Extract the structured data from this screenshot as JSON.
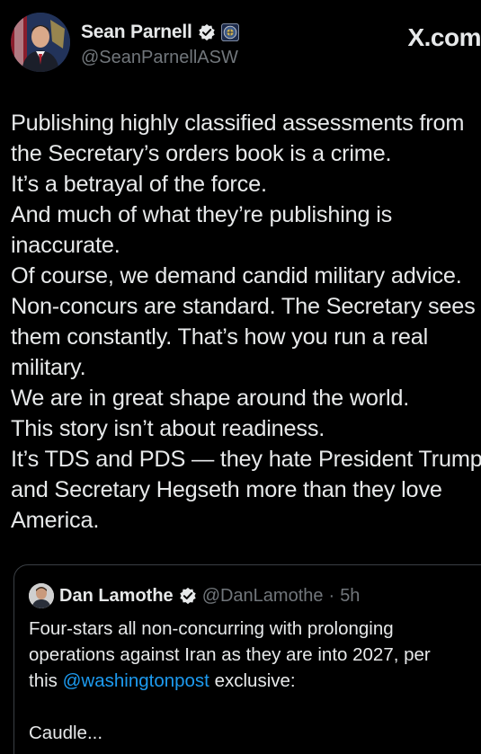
{
  "author": {
    "name": "Sean Parnell",
    "handle": "@SeanParnellASW",
    "verified_icon": "verified-badge-icon",
    "affiliation_icon": "dod-seal-icon"
  },
  "watermark": "X.com",
  "post": {
    "lines": [
      "Publishing highly classified assessments from",
      "the Secretary’s orders book is a crime.",
      "It’s a betrayal of the force.",
      "And much of what they’re publishing is",
      "inaccurate.",
      "Of course, we demand candid military advice.",
      "Non-concurs are standard. The Secretary sees",
      "them constantly. That’s how you run a real",
      "military.",
      "We are in great shape around the world.",
      "This story isn’t about readiness.",
      "It’s TDS and PDS — they hate President Trump",
      "and Secretary Hegseth more than they love",
      "America."
    ]
  },
  "quote": {
    "name": "Dan Lamothe",
    "handle": "@DanLamothe",
    "separator": "·",
    "time": "5h",
    "line1": "Four-stars all non-concurring with prolonging",
    "line2": "operations against Iran as they are into 2027, per",
    "line3_pre": "this",
    "mention": "@washingtonpost",
    "line3_post": "exclusive:",
    "line4": "Caudle..."
  },
  "colors": {
    "background": "#000000",
    "text": "#e7e9ea",
    "secondary": "#71767b",
    "link": "#1d9bf0",
    "verified": "#e7e9ea"
  }
}
